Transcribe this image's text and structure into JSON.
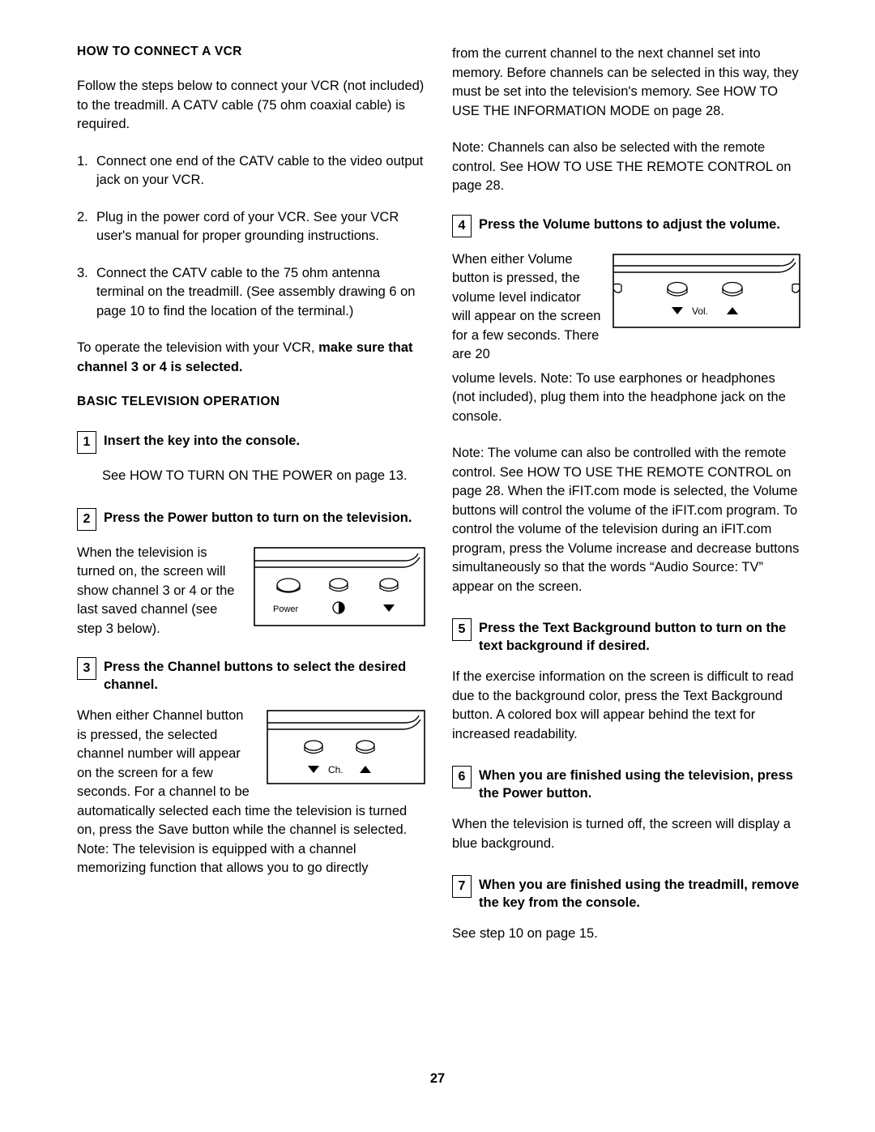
{
  "page": {
    "number": "27"
  },
  "left_column": {
    "heading_vcr": "HOW TO CONNECT A VCR",
    "intro": "Follow the steps below to connect your VCR (not included) to the treadmill. A CATV cable (75 ohm coaxial cable) is required.",
    "steps": [
      {
        "num": "1.",
        "text": "Connect one end of the CATV cable to the video output jack on your VCR."
      },
      {
        "num": "2.",
        "text": "Plug in the power cord of your VCR. See your VCR user's manual for proper grounding instructions."
      },
      {
        "num": "3.",
        "text": "Connect the CATV cable to the 75 ohm antenna terminal on the treadmill. (See assembly drawing 6 on page 10 to find the location of the terminal.)"
      }
    ],
    "closing_plain": "To operate the television with your VCR, ",
    "closing_bold": "make sure that channel 3 or 4 is selected.",
    "heading_basic": "BASIC TELEVISION OPERATION",
    "step1": {
      "num": "1",
      "title": "Insert the key into the console.",
      "body": "See HOW TO TURN ON THE POWER on page 13."
    },
    "step2": {
      "num": "2",
      "title": "Press the Power button to turn on the television.",
      "body": "When the television is turned on, the screen will show channel 3 or 4 or the last saved channel (see step 3 below)."
    },
    "step3": {
      "num": "3",
      "title": "Press the Channel buttons to select the desired channel.",
      "body": "When either Channel button is pressed, the selected channel number will appear on the screen for a few seconds. For a channel to be automatically selected each time the television is turned on, press the Save button while the channel is selected. Note: The television is equipped with a channel memorizing function that allows you to go directly"
    },
    "figure_power": {
      "label": "Power"
    },
    "figure_channel": {
      "label": "Ch."
    }
  },
  "right_column": {
    "continuation": "from the current channel to the next channel set into memory. Before channels can be selected in this way, they must be set into the television's memory. See HOW TO USE THE INFORMATION MODE on page 28.",
    "note_remote": "Note: Channels can also be selected with the remote control. See HOW TO USE THE REMOTE CONTROL on page 28.",
    "step4": {
      "num": "4",
      "title": "Press the Volume buttons to adjust the volume.",
      "body_wrap": "When either Volume button is pressed, the volume level indicator will appear on the screen for a few seconds. There are 20",
      "body_rest": "volume levels. Note: To use earphones or headphones (not included), plug them into the headphone jack on the console."
    },
    "note_volume": "Note: The volume can also be controlled with the remote control. See HOW TO USE THE REMOTE CONTROL on page 28. When the iFIT.com mode is selected, the Volume buttons will control the volume of the iFIT.com program. To control the volume of the television during an iFIT.com program, press the Volume increase and decrease buttons simultaneously so that the words “Audio Source: TV” appear on the screen.",
    "step5": {
      "num": "5",
      "title": "Press the Text Background button to turn on the text background if desired.",
      "body": "If the exercise information on the screen is difficult to read due to the background color, press the Text Background button. A colored box will appear behind the text for increased readability."
    },
    "step6": {
      "num": "6",
      "title": "When you are finished using the television, press the Power button.",
      "body": "When the television is turned off, the screen will display a blue background."
    },
    "step7": {
      "num": "7",
      "title": "When you are finished using the treadmill, remove the key from the console.",
      "body": "See step 10 on page 15."
    },
    "figure_volume": {
      "label": "Vol."
    }
  }
}
